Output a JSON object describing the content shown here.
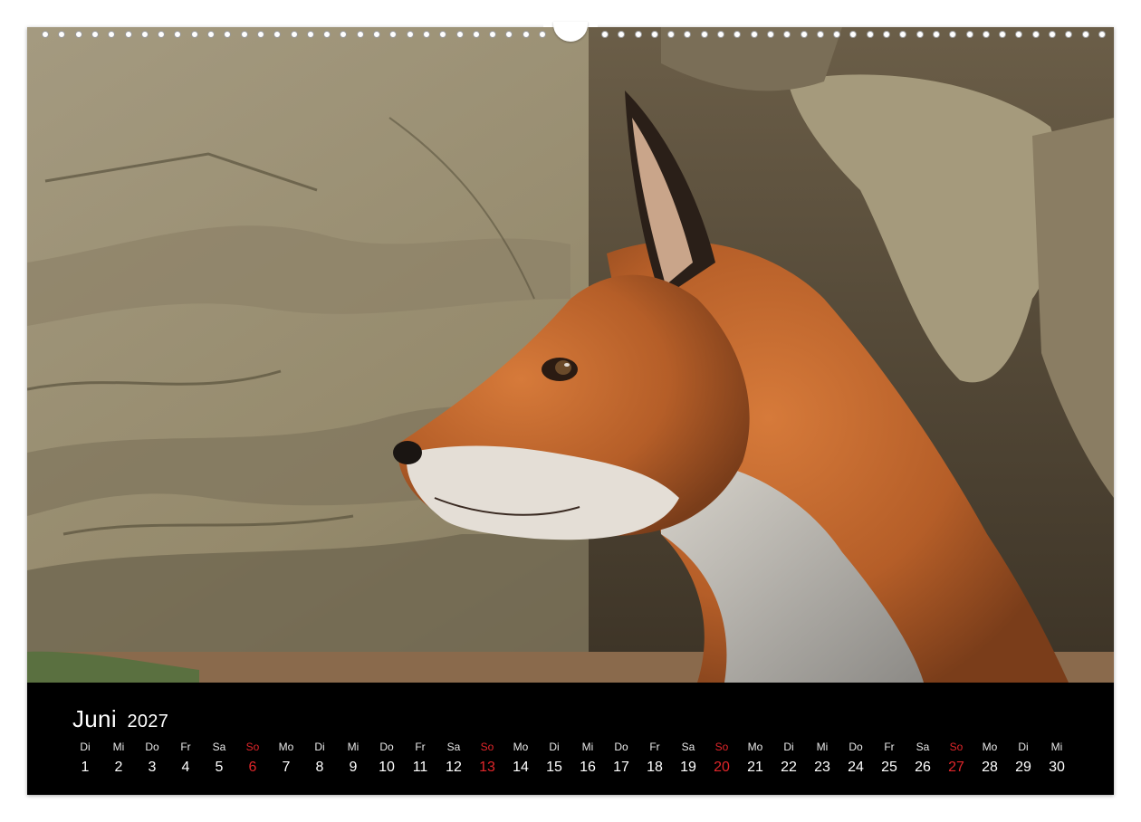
{
  "calendar": {
    "month": "Juni",
    "year": "2027",
    "days": [
      {
        "wd": "Di",
        "d": "1",
        "sun": false
      },
      {
        "wd": "Mi",
        "d": "2",
        "sun": false
      },
      {
        "wd": "Do",
        "d": "3",
        "sun": false
      },
      {
        "wd": "Fr",
        "d": "4",
        "sun": false
      },
      {
        "wd": "Sa",
        "d": "5",
        "sun": false
      },
      {
        "wd": "So",
        "d": "6",
        "sun": true
      },
      {
        "wd": "Mo",
        "d": "7",
        "sun": false
      },
      {
        "wd": "Di",
        "d": "8",
        "sun": false
      },
      {
        "wd": "Mi",
        "d": "9",
        "sun": false
      },
      {
        "wd": "Do",
        "d": "10",
        "sun": false
      },
      {
        "wd": "Fr",
        "d": "11",
        "sun": false
      },
      {
        "wd": "Sa",
        "d": "12",
        "sun": false
      },
      {
        "wd": "So",
        "d": "13",
        "sun": true
      },
      {
        "wd": "Mo",
        "d": "14",
        "sun": false
      },
      {
        "wd": "Di",
        "d": "15",
        "sun": false
      },
      {
        "wd": "Mi",
        "d": "16",
        "sun": false
      },
      {
        "wd": "Do",
        "d": "17",
        "sun": false
      },
      {
        "wd": "Fr",
        "d": "18",
        "sun": false
      },
      {
        "wd": "Sa",
        "d": "19",
        "sun": false
      },
      {
        "wd": "So",
        "d": "20",
        "sun": true
      },
      {
        "wd": "Mo",
        "d": "21",
        "sun": false
      },
      {
        "wd": "Di",
        "d": "22",
        "sun": false
      },
      {
        "wd": "Mi",
        "d": "23",
        "sun": false
      },
      {
        "wd": "Do",
        "d": "24",
        "sun": false
      },
      {
        "wd": "Fr",
        "d": "25",
        "sun": false
      },
      {
        "wd": "Sa",
        "d": "26",
        "sun": false
      },
      {
        "wd": "So",
        "d": "27",
        "sun": true
      },
      {
        "wd": "Mo",
        "d": "28",
        "sun": false
      },
      {
        "wd": "Di",
        "d": "29",
        "sun": false
      },
      {
        "wd": "Mi",
        "d": "30",
        "sun": false
      }
    ]
  },
  "colors": {
    "sunday": "#e0262a",
    "strip": "#000000"
  },
  "photo": {
    "subject": "fox-cub-icon"
  }
}
